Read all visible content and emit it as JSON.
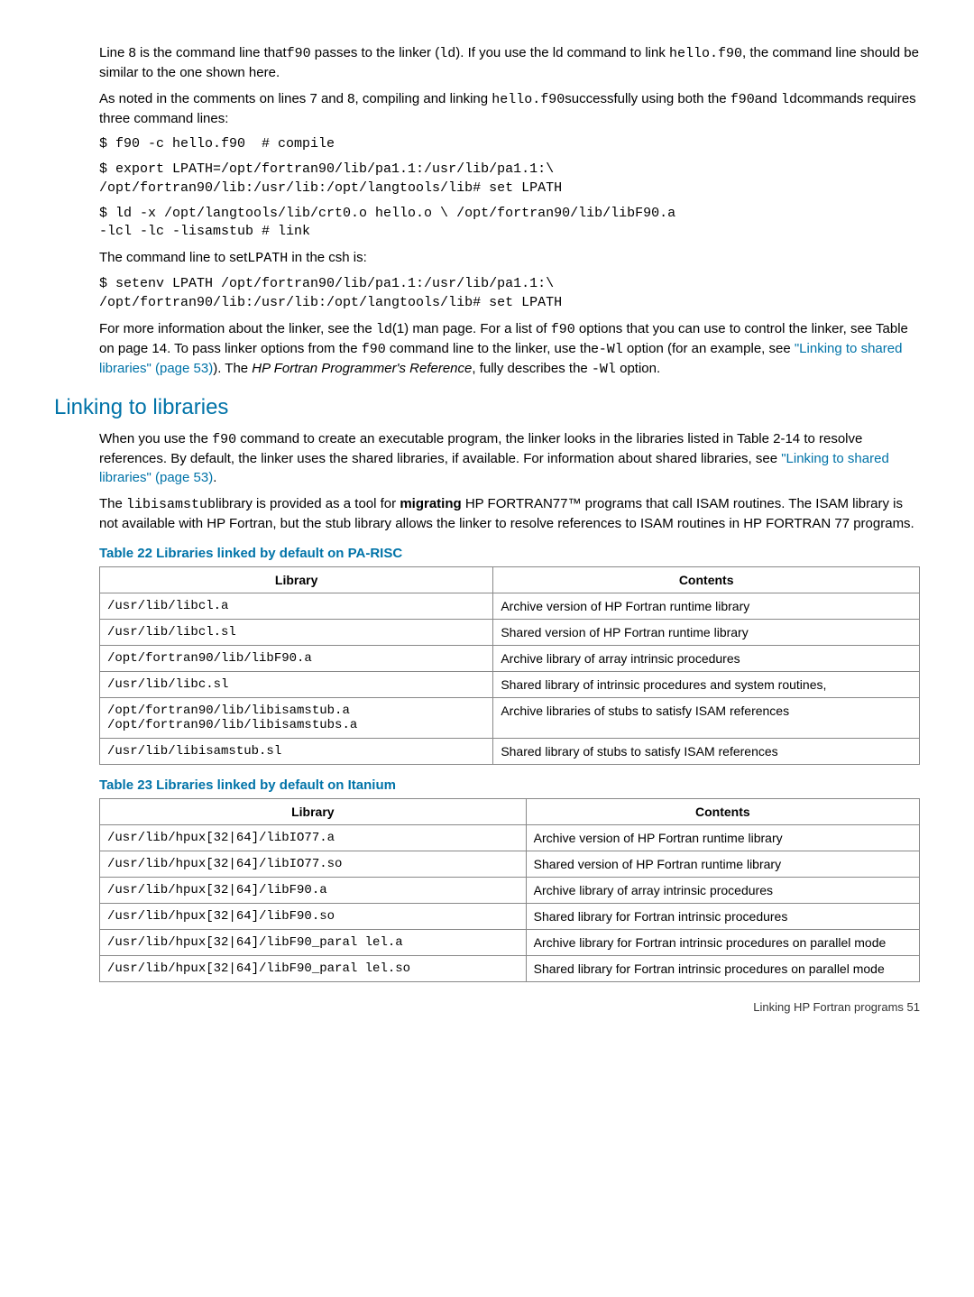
{
  "p1_a": "Line 8 is the command line that",
  "p1_b": " passes to the linker (",
  "p1_c": "). If you use the ld command to link ",
  "p1_d": ", the command line should be similar to the one shown here.",
  "p2_a": "As noted in the comments on lines 7 and 8, compiling and linking ",
  "p2_b": "successfully using both the ",
  "p2_c": "and ",
  "p2_d": "commands requires three command lines:",
  "code1": "$ f90 -c hello.f90  # compile",
  "code2": "$ export LPATH=/opt/fortran90/lib/pa1.1:/usr/lib/pa1.1:\\\n/opt/fortran90/lib:/usr/lib:/opt/langtools/lib# set LPATH",
  "code3": "$ ld -x /opt/langtools/lib/crt0.o hello.o \\ /opt/fortran90/lib/libF90.a\n-lcl -lc -lisamstub # link",
  "p3_a": "The command line to set",
  "p3_b": " in the csh is:",
  "code4": "$ setenv LPATH /opt/fortran90/lib/pa1.1:/usr/lib/pa1.1:\\\n/opt/fortran90/lib:/usr/lib:/opt/langtools/lib# set LPATH",
  "p4_a": "For more information about the linker, see the ",
  "p4_b": "(1) man page. For a list of ",
  "p4_c": " options that you can use to control the linker, see Table on page 14. To pass linker options from the ",
  "p4_d": " command line to the linker, use the",
  "p4_e": " option (for an example, see ",
  "p4_link1": "\"Linking to shared libraries\" (page 53)",
  "p4_f": "). The ",
  "p4_ref": "HP Fortran Programmer's Reference",
  "p4_g": ", fully describes the ",
  "p4_h": " option.",
  "section_heading": "Linking to libraries",
  "p5_a": "When you use the ",
  "p5_b": " command to create an executable program, the linker looks in the libraries listed in Table 2-14 to resolve references. By default, the linker uses the shared libraries, if available. For information about shared libraries, see ",
  "p5_link": "\"Linking to shared libraries\" (page 53)",
  "p5_c": ".",
  "p6_a": "The ",
  "p6_b": "library is provided as a tool for ",
  "p6_bold": "migrating",
  "p6_c": "  HP FORTRAN77™ programs that call ISAM routines. The ISAM library is not available with HP Fortran, but the stub library allows the linker to resolve references to ISAM routines in HP FORTRAN 77 programs.",
  "table22_title": "Table 22 Libraries linked by default on PA-RISC",
  "table23_title": "Table 23 Libraries linked by default on Itanium",
  "th_lib": "Library",
  "th_contents": "Contents",
  "t22": [
    {
      "lib": "/usr/lib/libcl.a",
      "desc": "Archive version of HP Fortran runtime library"
    },
    {
      "lib": "/usr/lib/libcl.sl",
      "desc": "Shared version of HP Fortran runtime library"
    },
    {
      "lib": "/opt/fortran90/lib/libF90.a",
      "desc": "Archive library of array intrinsic procedures"
    },
    {
      "lib": "/usr/lib/libc.sl",
      "desc": "Shared library of intrinsic procedures and system routines,"
    },
    {
      "lib": "/opt/fortran90/lib/libisamstub.a\n/opt/fortran90/lib/libisamstubs.a",
      "desc": "Archive libraries of stubs to satisfy ISAM references"
    },
    {
      "lib": "/usr/lib/libisamstub.sl",
      "desc": "Shared library of stubs to satisfy ISAM references"
    }
  ],
  "t23": [
    {
      "lib": "/usr/lib/hpux[32|64]/libIO77.a",
      "desc": "Archive version of HP Fortran runtime library"
    },
    {
      "lib": "/usr/lib/hpux[32|64]/libIO77.so",
      "desc": "Shared version of HP Fortran runtime library"
    },
    {
      "lib": "/usr/lib/hpux[32|64]/libF90.a",
      "desc": "Archive library of array intrinsic procedures"
    },
    {
      "lib": "/usr/lib/hpux[32|64]/libF90.so",
      "desc": "Shared library for Fortran intrinsic procedures"
    },
    {
      "lib": "/usr/lib/hpux[32|64]/libF90_paral lel.a",
      "desc": "Archive library for Fortran intrinsic procedures on parallel mode"
    },
    {
      "lib": "/usr/lib/hpux[32|64]/libF90_paral lel.so",
      "desc": "Shared library for Fortran intrinsic procedures on parallel mode"
    }
  ],
  "inline": {
    "f90": "f90",
    "ld": "ld",
    "hello": "hello.f90",
    "ldcmd": "ld",
    "LPATH": "LPATH",
    "Wl": "-Wl",
    "libisamstub": "libisamstub"
  },
  "footer": "Linking HP Fortran programs     51"
}
